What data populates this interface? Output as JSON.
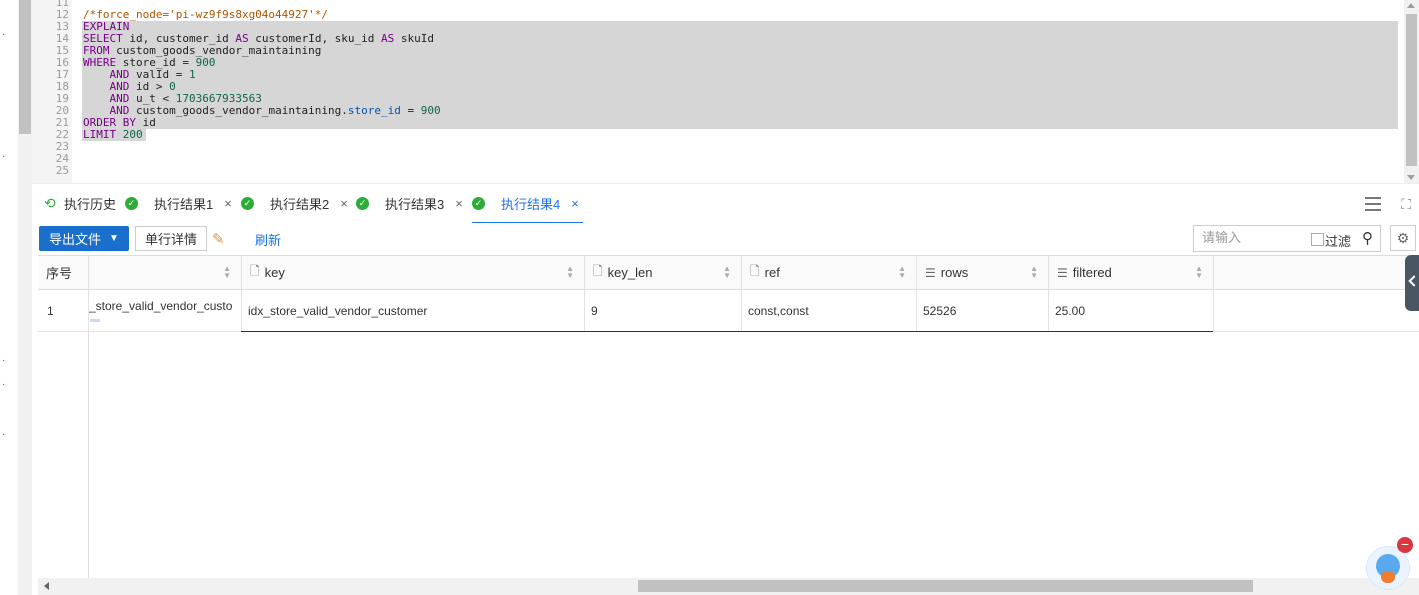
{
  "editor": {
    "lines": [
      {
        "n": "11",
        "t": ""
      },
      {
        "n": "12",
        "t": "/*force_node='pi-wz9f9s8xg04o44927'*/"
      },
      {
        "n": "13",
        "t": "EXPLAIN"
      },
      {
        "n": "14",
        "t": "SELECT id, customer_id AS customerId, sku_id AS skuId"
      },
      {
        "n": "15",
        "t": "FROM custom_goods_vendor_maintaining"
      },
      {
        "n": "16",
        "t": "WHERE store_id = 900"
      },
      {
        "n": "17",
        "t": "    AND valId = 1"
      },
      {
        "n": "18",
        "t": "    AND id > 0"
      },
      {
        "n": "19",
        "t": "    AND u_t < 1703667933563"
      },
      {
        "n": "20",
        "t": "    AND custom_goods_vendor_maintaining.store_id = 900"
      },
      {
        "n": "21",
        "t": "ORDER BY id"
      },
      {
        "n": "22",
        "t": "LIMIT 200"
      },
      {
        "n": "23",
        "t": ""
      },
      {
        "n": "24",
        "t": ""
      },
      {
        "n": "25",
        "t": ""
      }
    ]
  },
  "tabs": {
    "history": "执行历史",
    "results": [
      {
        "label": "执行结果1",
        "close": "×"
      },
      {
        "label": "执行结果2",
        "close": "×"
      },
      {
        "label": "执行结果3",
        "close": "×"
      },
      {
        "label": "执行结果4",
        "close": "×"
      }
    ],
    "active_index": 3
  },
  "toolbar": {
    "export_label": "导出文件",
    "detail_label": "单行详情",
    "refresh_label": "刷新",
    "search_placeholder": "请输入",
    "filter_label": "过滤"
  },
  "grid": {
    "row_number_header": "序号",
    "columns": [
      {
        "name": "",
        "icon": ""
      },
      {
        "name": "key",
        "icon": "doc-icon"
      },
      {
        "name": "key_len",
        "icon": "doc-icon"
      },
      {
        "name": "ref",
        "icon": "doc-icon"
      },
      {
        "name": "rows",
        "icon": "list-icon"
      },
      {
        "name": "filtered",
        "icon": "list-icon"
      }
    ],
    "rows": [
      {
        "num": "1",
        "cells": [
          "_store_valid_vendor_custo",
          "idx_store_valid_vendor_customer",
          "9",
          "const,const",
          "52526",
          "25.00"
        ]
      }
    ]
  },
  "colors": {
    "accent": "#1a73e8",
    "primary_button": "#1a6fcc",
    "success": "#2eac3a",
    "selection": "#d6d6d6"
  }
}
